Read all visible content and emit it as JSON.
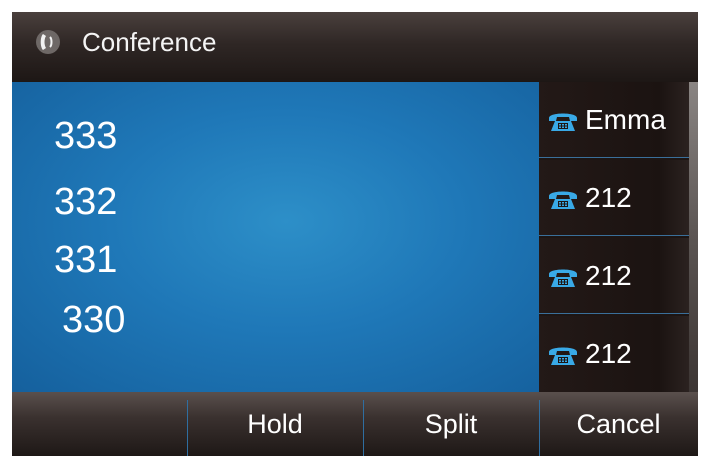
{
  "header": {
    "icon": "handset-icon",
    "title": "Conference"
  },
  "participants": [
    "333",
    "332",
    "331",
    "330"
  ],
  "line_keys": [
    {
      "icon": "phone-icon",
      "label": "Emma"
    },
    {
      "icon": "phone-icon",
      "label": "212"
    },
    {
      "icon": "phone-icon",
      "label": "212"
    },
    {
      "icon": "phone-icon",
      "label": "212"
    }
  ],
  "softkeys": [
    "",
    "Hold",
    "Split",
    "Cancel"
  ],
  "colors": {
    "main_blue": "#1f78b8",
    "phone_icon": "#39a9e6",
    "divider": "#2f6ea0"
  }
}
